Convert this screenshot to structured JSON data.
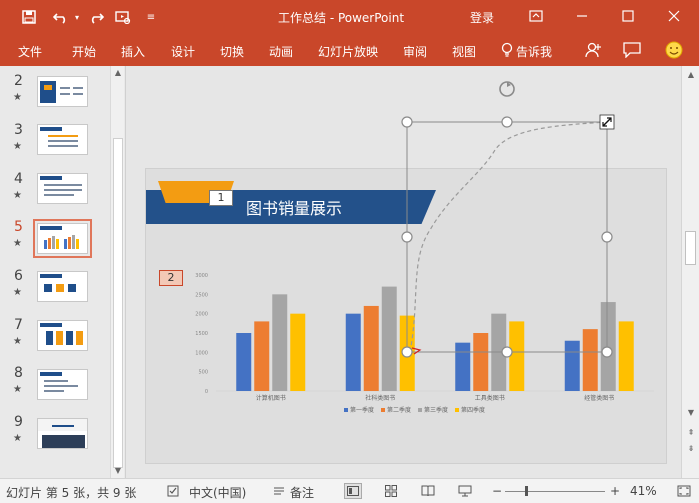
{
  "window": {
    "title": "工作总结  -  PowerPoint",
    "login": "登录"
  },
  "ribbon": {
    "tabs": [
      "文件",
      "开始",
      "插入",
      "设计",
      "切换",
      "动画",
      "幻灯片放映",
      "审阅",
      "视图"
    ],
    "tell_me": "告诉我"
  },
  "thumbnails": {
    "items": [
      {
        "number": "2",
        "star": "★"
      },
      {
        "number": "3",
        "star": "★"
      },
      {
        "number": "4",
        "star": "★"
      },
      {
        "number": "5",
        "star": "★"
      },
      {
        "number": "6",
        "star": "★"
      },
      {
        "number": "7",
        "star": "★"
      },
      {
        "number": "8",
        "star": "★"
      },
      {
        "number": "9",
        "star": "★"
      }
    ],
    "active_index": 3
  },
  "slide": {
    "number_box_1": "1",
    "title": "图书销量展示",
    "number_box_2": "2"
  },
  "chart_data": {
    "type": "bar",
    "categories": [
      "计算机图书",
      "社科类图书",
      "工具类图书",
      "经管类图书"
    ],
    "series": [
      {
        "name": "第一季度",
        "values": [
          1500,
          2000,
          1250,
          1300
        ],
        "color": "#4472c4"
      },
      {
        "name": "第二季度",
        "values": [
          1800,
          2200,
          1500,
          1600
        ],
        "color": "#ed7d31"
      },
      {
        "name": "第三季度",
        "values": [
          2500,
          2700,
          2000,
          2300
        ],
        "color": "#a5a5a5"
      },
      {
        "name": "第四季度",
        "values": [
          2000,
          1950,
          1800,
          1800
        ],
        "color": "#ffc000"
      }
    ],
    "yticks": [
      "0",
      "500",
      "1000",
      "1500",
      "2000",
      "2500",
      "3000"
    ],
    "ylim": [
      0,
      3000
    ],
    "legend_position": "bottom",
    "grid": false
  },
  "statusbar": {
    "slide_info": "幻灯片 第 5 张，共 9 张",
    "language": "中文(中国)",
    "notes": "备注",
    "zoom_minus": "−",
    "zoom_plus": "+",
    "zoom": "41%"
  },
  "colors": {
    "accent": "#c9472a",
    "title_band": "#23518a",
    "orange": "#f39c12"
  }
}
